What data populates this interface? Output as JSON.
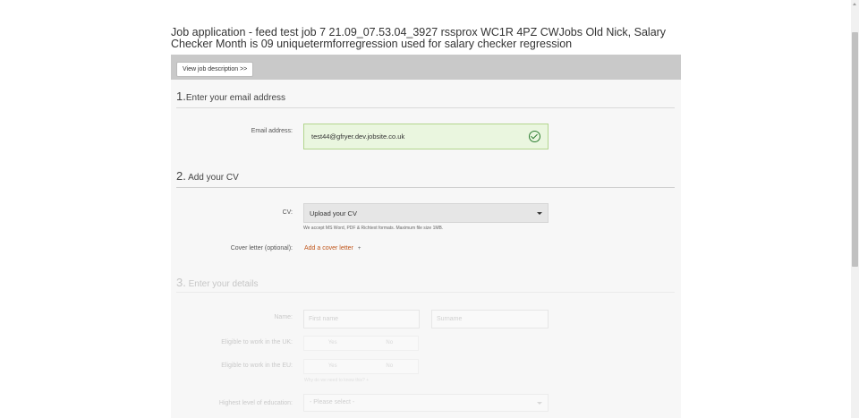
{
  "page": {
    "title": "Job application - feed test job 7 21.09_07.53.04_3927 rssprox WC1R 4PZ CWJobs Old Nick, Salary Checker Month is 09 uniquetermforregression used for salary checker regression"
  },
  "header": {
    "view_job_label": "View job description >>"
  },
  "section1": {
    "number": "1.",
    "title": "Enter your email address",
    "email_label": "Email address:",
    "email_value": "test44@gfryer.dev.jobsite.co.uk"
  },
  "section2": {
    "number": "2.",
    "title": "Add your CV",
    "cv_label": "CV:",
    "cv_selected": "Upload your CV",
    "cv_hint": "We accept MS Word, PDF & Richtext formats. Maximum file size 1MB.",
    "cover_label": "Cover letter (optional):",
    "cover_link": "Add a cover letter",
    "cover_link_icon": "+"
  },
  "section3": {
    "number": "3.",
    "title": "Enter your details",
    "name_label": "Name:",
    "first_name_placeholder": "First name",
    "surname_placeholder": "Surname",
    "uk_label": "Eligible to work in the UK:",
    "eu_label": "Eligible to work in the EU:",
    "yes": "Yes",
    "no": "No",
    "note": "Why do we need to know this? +",
    "education_label": "Highest level of education:",
    "education_selected": "- Please select -"
  },
  "colors": {
    "accent_link": "#c0561b",
    "success_border": "#b3d58e",
    "success_bg": "#eaf6df",
    "check": "#2e7d32"
  }
}
